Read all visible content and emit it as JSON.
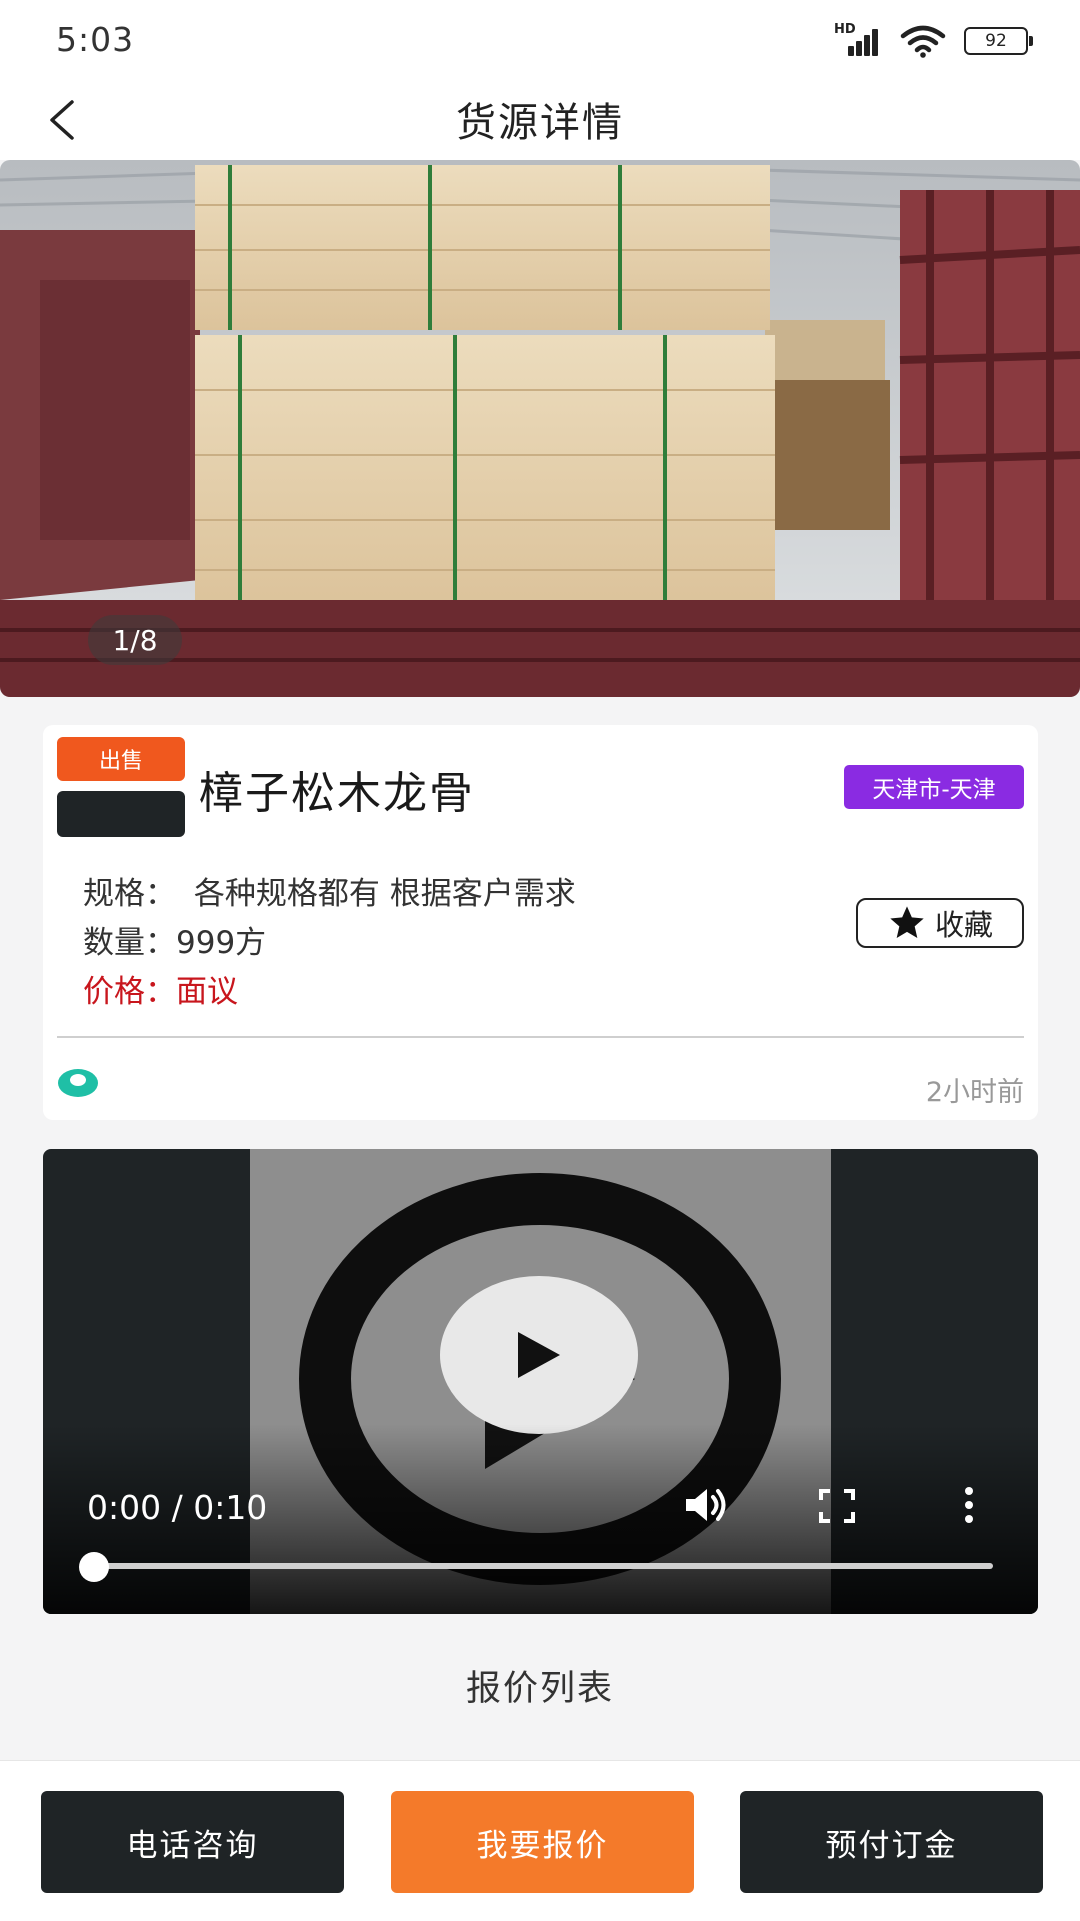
{
  "status_bar": {
    "time": "5:03",
    "network_label": "HD",
    "battery": "92"
  },
  "header": {
    "title": "货源详情"
  },
  "gallery": {
    "counter": "1/8"
  },
  "product": {
    "tag": "出售",
    "title": "樟子松木龙骨",
    "location": "天津市-天津",
    "spec_label": "规格：",
    "spec_value": "各种规格都有 根据客户需求",
    "quantity_label": "数量：",
    "quantity_value": "999方",
    "price_label": "价格：",
    "price_value": "面议",
    "favorite_label": "收藏",
    "posted_time": "2小时前"
  },
  "video": {
    "time": "0:00 / 0:10",
    "progress": 0
  },
  "quotes": {
    "heading": "报价列表"
  },
  "actions": {
    "call": "电话咨询",
    "quote": "我要报价",
    "deposit": "预付订金"
  },
  "colors": {
    "accent_orange": "#f47a2a",
    "sale_tag": "#f0581e",
    "location_purple": "#8a2be2",
    "price_red": "#c8161d",
    "dark_button": "#1f2426"
  }
}
